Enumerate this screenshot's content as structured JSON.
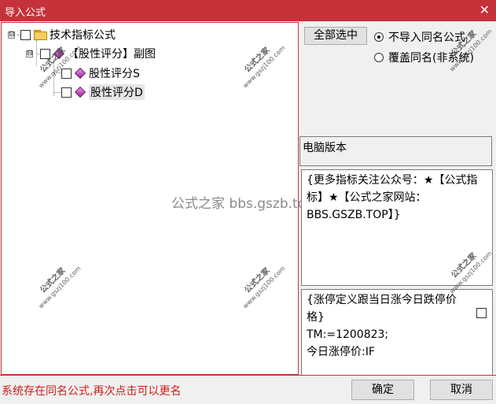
{
  "window": {
    "title": "导入公式",
    "close_glyph": "✕"
  },
  "tree": {
    "root": {
      "label": "技术指标公式",
      "expander": "⊟"
    },
    "child": {
      "label": "【股性评分】副图",
      "expander": "⊟"
    },
    "leaves": [
      {
        "label": "股性评分S"
      },
      {
        "label": "股性评分D"
      }
    ]
  },
  "watermark": {
    "brand": "公式之家",
    "site": "www.gszj100.com",
    "center": "公式之家 bbs.gszb.top"
  },
  "controls": {
    "select_all": "全部选中",
    "radio_options": [
      {
        "label": "不导入同名公式",
        "checked": true
      },
      {
        "label": "覆盖同名(非系统)",
        "checked": false
      }
    ]
  },
  "version_label": "电脑版本",
  "description": "{更多指标关注公众号：★【公式指标】★【公式之家网站：BBS.GSZB.TOP】}",
  "code_preview": "{涨停定义跟当日涨今日跌停价格}\nTM:=1200823;\n今日涨停价:IF",
  "status": {
    "message": "系统存在同名公式,再次点击可以更名"
  },
  "buttons": {
    "ok": "确定",
    "cancel": "取消"
  }
}
